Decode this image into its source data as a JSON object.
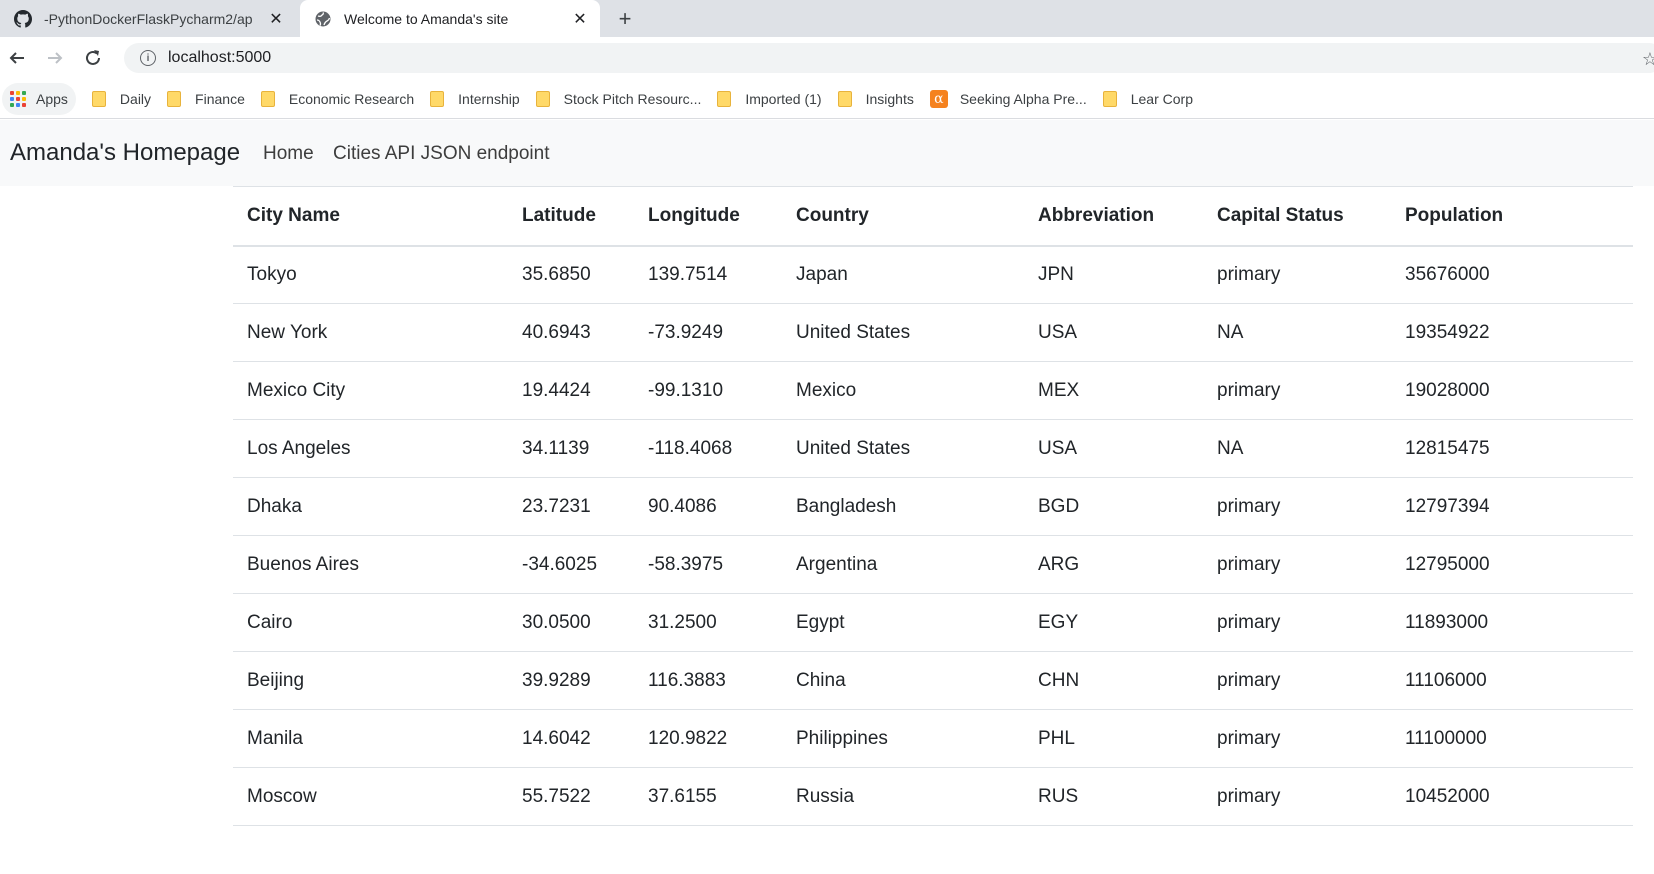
{
  "browser": {
    "tabs": [
      {
        "title": "-PythonDockerFlaskPycharm2/ap",
        "favicon": "github-icon",
        "active": false
      },
      {
        "title": "Welcome to Amanda's site",
        "favicon": "globe-icon",
        "active": true
      }
    ],
    "url": "localhost:5000",
    "bookmarks": {
      "apps_label": "Apps",
      "items": [
        {
          "label": "Daily",
          "icon": "folder-icon"
        },
        {
          "label": "Finance",
          "icon": "folder-icon"
        },
        {
          "label": "Economic Research",
          "icon": "folder-icon"
        },
        {
          "label": "Internship",
          "icon": "folder-icon"
        },
        {
          "label": "Stock Pitch Resourc...",
          "icon": "folder-icon"
        },
        {
          "label": "Imported (1)",
          "icon": "folder-icon"
        },
        {
          "label": "Insights",
          "icon": "folder-icon"
        },
        {
          "label": "Seeking Alpha Pre...",
          "icon": "seeking-alpha-icon"
        },
        {
          "label": "Lear Corp",
          "icon": "folder-icon"
        }
      ]
    }
  },
  "page": {
    "brand": "Amanda's Homepage",
    "nav": [
      "Home",
      "Cities API JSON endpoint"
    ]
  },
  "table": {
    "headers": [
      "City Name",
      "Latitude",
      "Longitude",
      "Country",
      "Abbreviation",
      "Capital Status",
      "Population"
    ],
    "rows": [
      [
        "Tokyo",
        "35.6850",
        "139.7514",
        "Japan",
        "JPN",
        "primary",
        "35676000"
      ],
      [
        "New York",
        "40.6943",
        "-73.9249",
        "United States",
        "USA",
        "NA",
        "19354922"
      ],
      [
        "Mexico City",
        "19.4424",
        "-99.1310",
        "Mexico",
        "MEX",
        "primary",
        "19028000"
      ],
      [
        "Los Angeles",
        "34.1139",
        "-118.4068",
        "United States",
        "USA",
        "NA",
        "12815475"
      ],
      [
        "Dhaka",
        "23.7231",
        "90.4086",
        "Bangladesh",
        "BGD",
        "primary",
        "12797394"
      ],
      [
        "Buenos Aires",
        "-34.6025",
        "-58.3975",
        "Argentina",
        "ARG",
        "primary",
        "12795000"
      ],
      [
        "Cairo",
        "30.0500",
        "31.2500",
        "Egypt",
        "EGY",
        "primary",
        "11893000"
      ],
      [
        "Beijing",
        "39.9289",
        "116.3883",
        "China",
        "CHN",
        "primary",
        "11106000"
      ],
      [
        "Manila",
        "14.6042",
        "120.9822",
        "Philippines",
        "PHL",
        "primary",
        "11100000"
      ],
      [
        "Moscow",
        "55.7522",
        "37.6155",
        "Russia",
        "RUS",
        "primary",
        "10452000"
      ]
    ]
  }
}
